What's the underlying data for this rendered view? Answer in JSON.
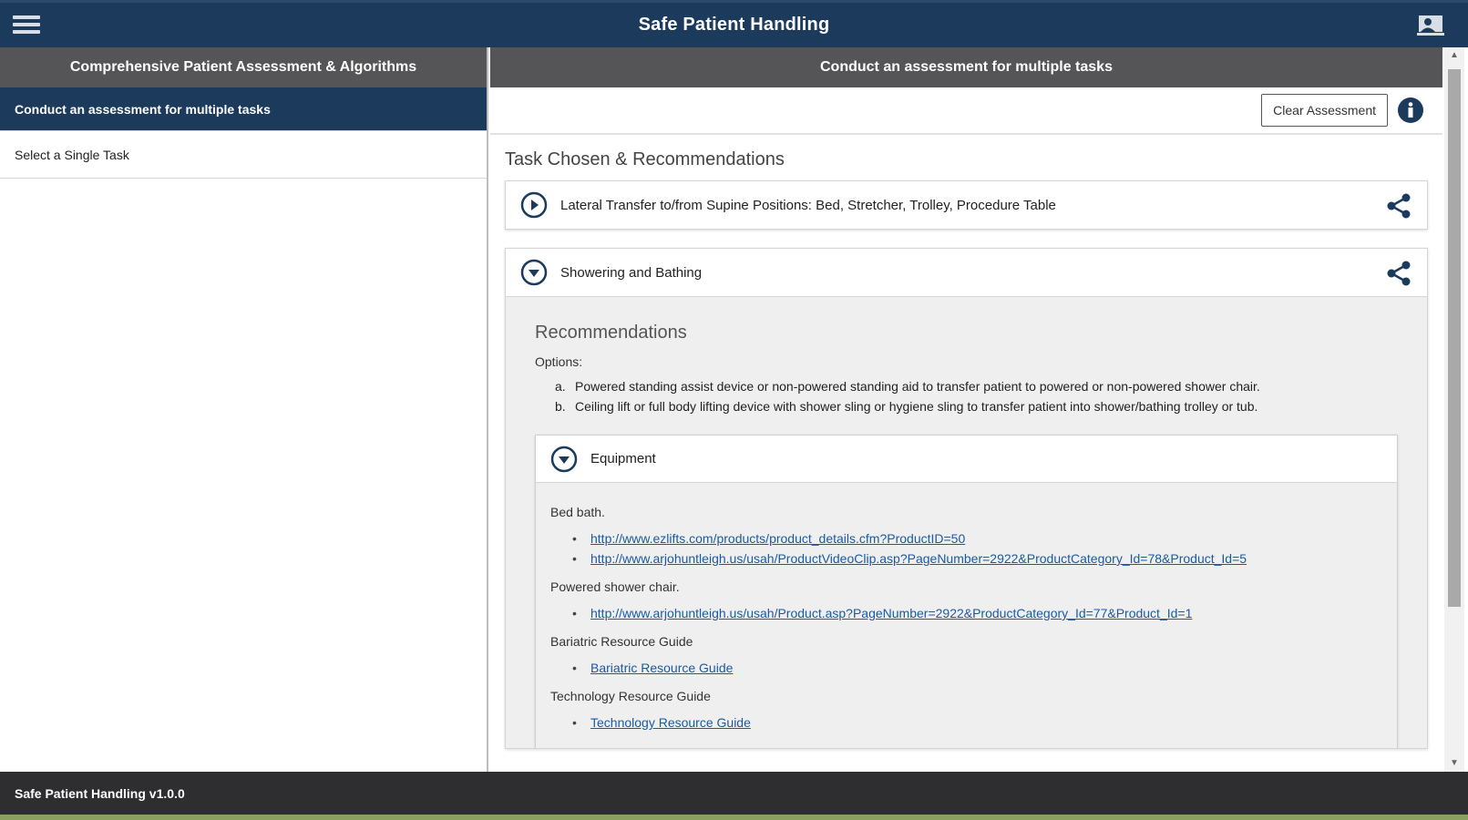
{
  "app": {
    "title": "Safe Patient Handling"
  },
  "left": {
    "header": "Comprehensive Patient Assessment & Algorithms",
    "items": [
      {
        "label": "Conduct an assessment for multiple tasks",
        "active": true
      },
      {
        "label": "Select a Single Task",
        "active": false
      }
    ]
  },
  "right": {
    "header": "Conduct an assessment for multiple tasks",
    "clear_button": "Clear Assessment",
    "section_title": "Task Chosen & Recommendations",
    "tasks": [
      {
        "label": "Lateral Transfer to/from Supine Positions: Bed, Stretcher, Trolley, Procedure Table",
        "expanded": false
      },
      {
        "label": "Showering and Bathing",
        "expanded": true
      }
    ],
    "recommendations": {
      "title": "Recommendations",
      "options_label": "Options:",
      "options": [
        {
          "marker": "a.",
          "text": "Powered standing assist device or non-powered standing aid to transfer patient to powered or non-powered shower chair."
        },
        {
          "marker": "b.",
          "text": "Ceiling lift or full body lifting device with shower sling or hygiene sling to transfer patient into shower/bathing trolley or tub."
        }
      ]
    },
    "equipment": {
      "label": "Equipment",
      "groups": [
        {
          "label": "Bed bath.",
          "links": [
            "http://www.ezlifts.com/products/product_details.cfm?ProductID=50",
            "http://www.arjohuntleigh.us/usah/ProductVideoClip.asp?PageNumber=2922&ProductCategory_Id=78&Product_Id=5"
          ]
        },
        {
          "label": "Powered shower chair.",
          "links": [
            "http://www.arjohuntleigh.us/usah/Product.asp?PageNumber=2922&ProductCategory_Id=77&Product_Id=1"
          ]
        },
        {
          "label": "Bariatric Resource Guide",
          "links": [
            "Bariatric Resource Guide"
          ]
        },
        {
          "label": "Technology Resource Guide",
          "links": [
            "Technology Resource Guide"
          ]
        }
      ]
    }
  },
  "footer": {
    "version": "Safe Patient Handling v1.0.0"
  },
  "colors": {
    "primary": "#1b3a5c",
    "header_gray": "#555557",
    "link": "#1a5aa6",
    "footer": "#2e2e30"
  }
}
